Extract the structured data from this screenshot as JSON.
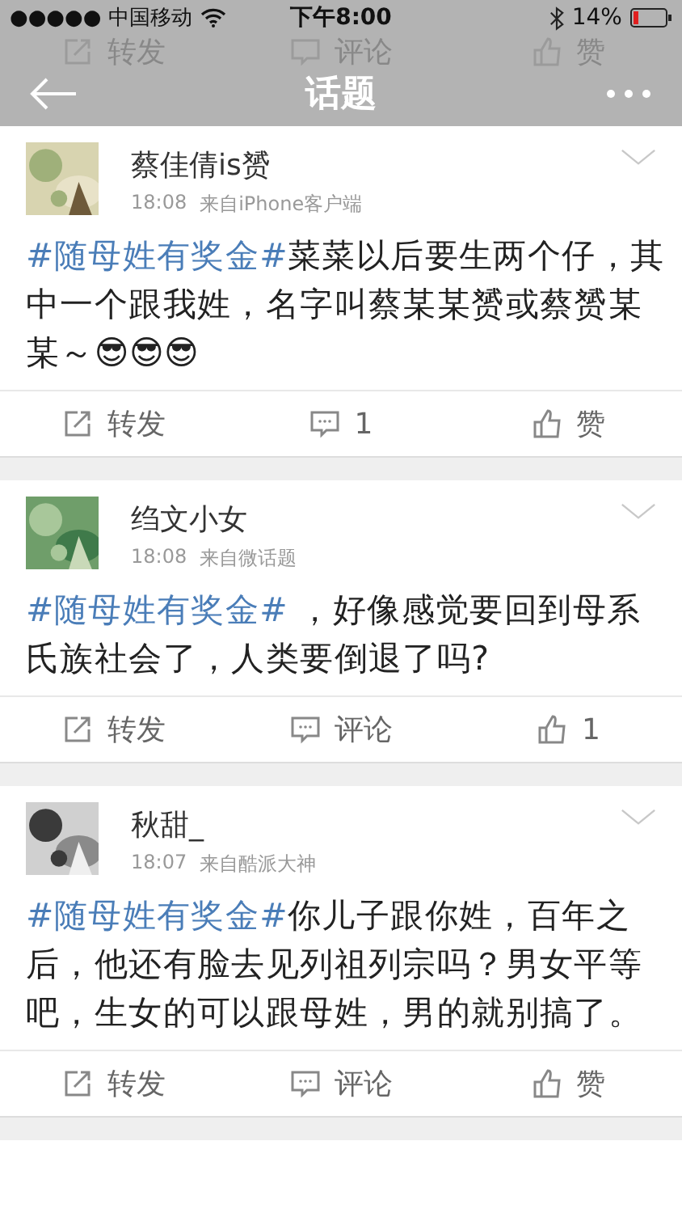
{
  "status_bar": {
    "carrier": "●●●●● 中国移动",
    "time": "下午8:00",
    "battery": "14%"
  },
  "nav": {
    "title": "话题"
  },
  "ghost_actions": [
    "转发",
    "评论",
    "赞"
  ],
  "posts": [
    {
      "name": "蔡佳倩is赟",
      "time": "18:08",
      "source": "来自iPhone客户端",
      "hashtag": "#随母姓有奖金#",
      "text": "菜菜以后要生两个仔，其中一个跟我姓，名字叫蔡某某赟或蔡赟某某～😎😎😎",
      "actions": [
        "转发",
        "1",
        "赞"
      ]
    },
    {
      "name": "绉文小女",
      "time": "18:08",
      "source": "来自微话题",
      "hashtag": "#随母姓有奖金#",
      "text": " ，好像感觉要回到母系氏族社会了，人类要倒退了吗?",
      "actions": [
        "转发",
        "评论",
        "1"
      ]
    },
    {
      "name": "秋甜_",
      "time": "18:07",
      "source": "来自酷派大神",
      "hashtag": "#随母姓有奖金#",
      "text": "你儿子跟你姓，百年之后，他还有脸去见列祖列宗吗？男女平等吧，生女的可以跟母姓，男的就别搞了。",
      "actions": [
        "转发",
        "评论",
        "赞"
      ]
    }
  ]
}
